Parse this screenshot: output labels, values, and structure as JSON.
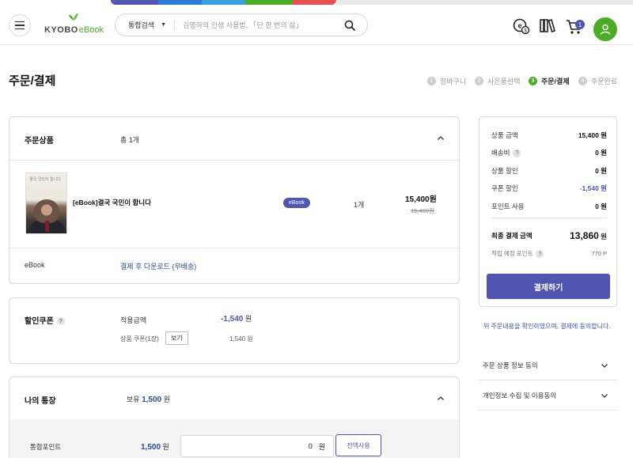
{
  "header": {
    "logo_main": "KYOBO",
    "logo_sub": "eBook",
    "search_category": "통합검색",
    "search_placeholder": "김영하의 인생 사용법, 「단 한 번의 삶」",
    "cart_count": "1"
  },
  "page": {
    "title": "주문/결제",
    "steps": [
      {
        "num": "1",
        "label": "장바구니"
      },
      {
        "num": "2",
        "label": "사은품선택"
      },
      {
        "num": "3",
        "label": "주문/결제"
      },
      {
        "num": "4",
        "label": "주문완료"
      }
    ],
    "active_step": 3
  },
  "order_items": {
    "label": "주문상품",
    "count_text": "총 1개",
    "book_title": "[eBook]결국 국민이 합니다",
    "cover_text": "결국 국민이 합니다",
    "format_badge": "eBook",
    "quantity": "1개",
    "price": "15,400원",
    "original_price": "15,400원",
    "delivery_label": "eBook",
    "delivery_text": "결제 후 다운로드 (무배송)"
  },
  "coupon": {
    "label": "할인쿠폰",
    "applied_label": "적용금액",
    "applied_value": "-1,540",
    "applied_unit": "원",
    "product_coupon": "상품 쿠폰(1장)",
    "view_button": "보기",
    "product_coupon_value": "1,540 원"
  },
  "wallet": {
    "label": "나의 통장",
    "owned_label": "보유",
    "owned_value": "1,500",
    "owned_unit": "원",
    "point_label": "통합포인트",
    "point_value": "1,500",
    "point_unit": "원",
    "input_value": "0",
    "input_unit": "원",
    "all_button": "전액사용"
  },
  "summary": {
    "rows": [
      {
        "label": "상품 금액",
        "value": "15,400 원"
      },
      {
        "label": "배송비",
        "value": "0 원"
      },
      {
        "label": "상품 할인",
        "value": "0 원"
      },
      {
        "label": "쿠폰 할인",
        "value": "-1,540 원"
      },
      {
        "label": "포인트 사용",
        "value": "0 원"
      }
    ],
    "final_label": "최종 결제 금액",
    "final_value": "13,860",
    "final_unit": "원",
    "earn_label": "적립 예정 포인트",
    "earn_value": "770 P",
    "pay_button": "결제하기"
  },
  "agreement": {
    "note": "위 주문내용을 확인하였으며, 결제에 동의합니다.",
    "items": [
      "주문 상품 정보 동의",
      "개인정보 수집 및 이용동의"
    ]
  },
  "colors": {
    "accent": "#5055b1",
    "brand_green": "#4dac27",
    "link_blue": "#2b4c9b"
  }
}
